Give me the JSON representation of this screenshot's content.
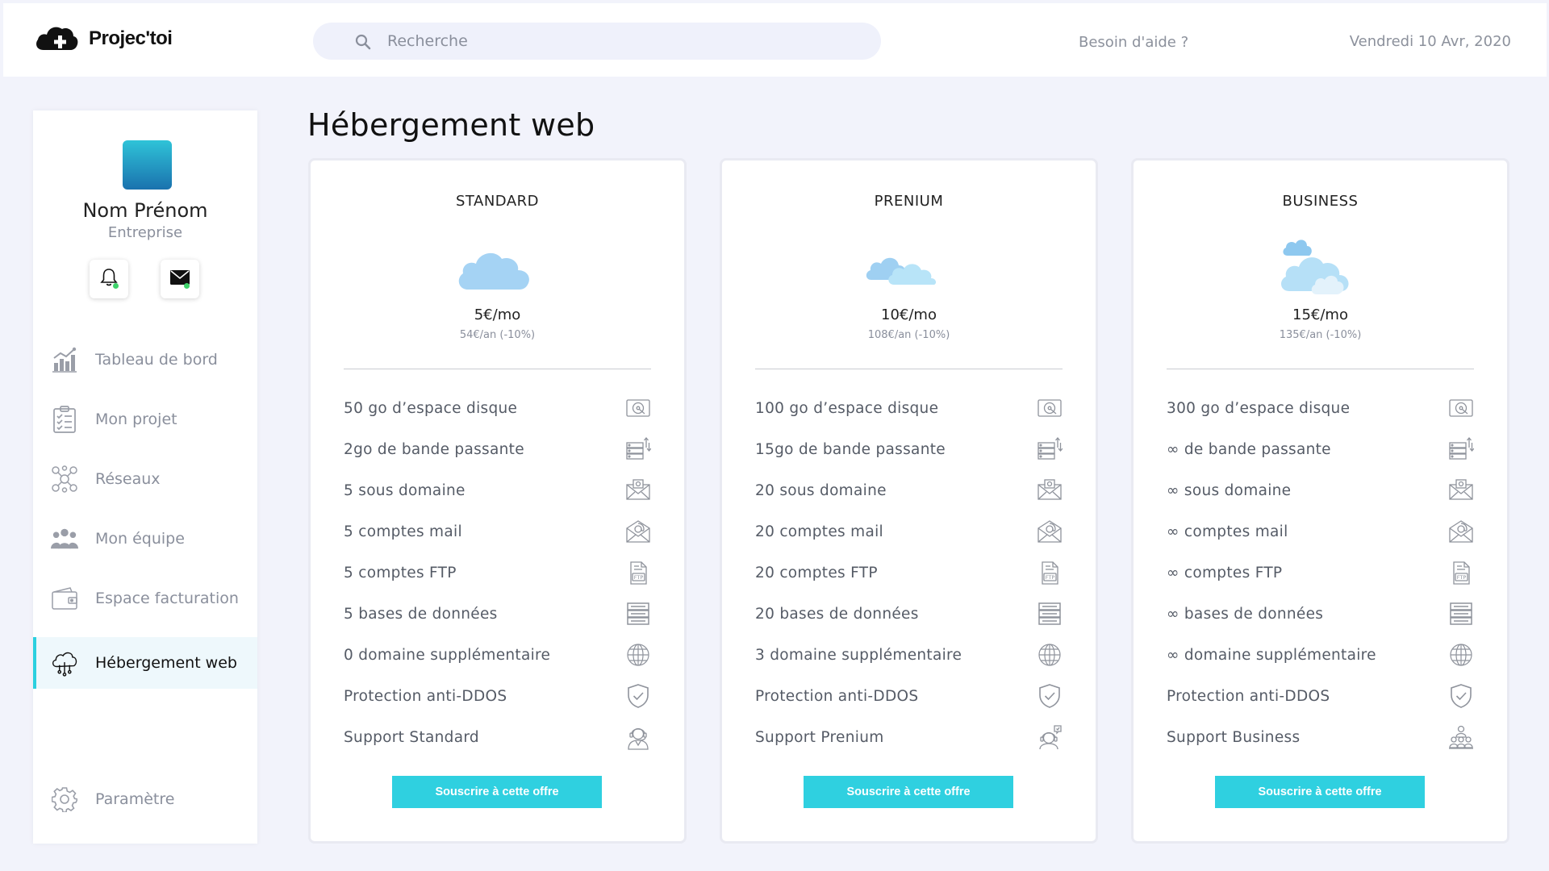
{
  "header": {
    "brand": "Projec'toi",
    "search_placeholder": "Recherche",
    "help": "Besoin d'aide ?",
    "date": "Vendredi 10 Avr, 2020"
  },
  "sidebar": {
    "user_name": "Nom Prénom",
    "user_company": "Entreprise",
    "items": [
      {
        "label": "Tableau de bord",
        "icon": "chart-icon"
      },
      {
        "label": "Mon projet",
        "icon": "clipboard-icon"
      },
      {
        "label": "Réseaux",
        "icon": "network-icon"
      },
      {
        "label": "Mon équipe",
        "icon": "team-icon"
      },
      {
        "label": "Espace facturation",
        "icon": "wallet-icon"
      },
      {
        "label": "Hébergement web",
        "icon": "cloud-hosting-icon",
        "active": true
      }
    ],
    "settings_label": "Paramètre"
  },
  "main": {
    "title": "Hébergement web",
    "cta_color": "#2fd0e0",
    "plans": [
      {
        "name": "STANDARD",
        "price": "5€/mo",
        "price_year": "54€/an (-10%)",
        "features": [
          "50 go d’espace disque",
          "2go de bande passante",
          "5 sous domaine",
          "5 comptes mail",
          "5 comptes FTP",
          "5 bases de données",
          "0 domaine supplémentaire",
          "Protection anti-DDOS",
          "Support Standard"
        ],
        "button": "Souscrire à cette offre"
      },
      {
        "name": "PRENIUM",
        "price": "10€/mo",
        "price_year": "108€/an (-10%)",
        "features": [
          "100 go d’espace disque",
          "15go de bande passante",
          "20 sous domaine",
          "20 comptes mail",
          "20 comptes FTP",
          "20 bases de données",
          "3 domaine supplémentaire",
          "Protection anti-DDOS",
          "Support Prenium"
        ],
        "button": "Souscrire à cette offre"
      },
      {
        "name": "BUSINESS",
        "price": "15€/mo",
        "price_year": "135€/an (-10%)",
        "features": [
          "300 go d’espace disque",
          "∞ de bande passante",
          "∞ sous domaine",
          "∞ comptes mail",
          "∞ comptes FTP",
          "∞ bases de données",
          "∞ domaine supplémentaire",
          "Protection anti-DDOS",
          "Support Business"
        ],
        "button": "Souscrire à cette offre"
      }
    ]
  }
}
